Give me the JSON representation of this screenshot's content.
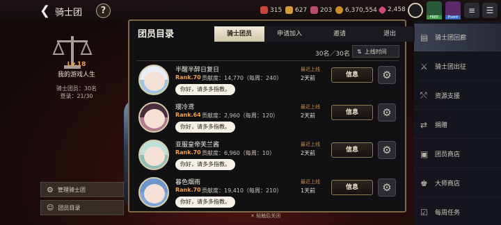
{
  "header": {
    "back_icon": "back-arrow-icon",
    "title": "骑士团",
    "help": "?",
    "resources": [
      {
        "icon": "energy-icon",
        "value": "315",
        "color": "#c9463a"
      },
      {
        "icon": "gold-bar-icon",
        "value": "627",
        "color": "#d59a3a"
      },
      {
        "icon": "ticket-icon",
        "value": "203",
        "color": "#b84a6a"
      },
      {
        "icon": "coin-icon",
        "value": "6,370,554",
        "color": "#c98c2a"
      },
      {
        "icon": "gem-icon",
        "value": "2,458",
        "color": "#d04a7a"
      }
    ],
    "badges": {
      "free": "FREE",
      "event": "Event"
    }
  },
  "guild": {
    "level": "Lv.18",
    "name": "我的游戏人生",
    "members": "骑士团员：30名",
    "online": "登录：21/30"
  },
  "left_buttons": {
    "manage": "管理骑士团",
    "member_list": "团员目录"
  },
  "modal": {
    "title": "团员目录",
    "tabs": [
      "骑士团员",
      "申请加入",
      "邀请",
      "退出"
    ],
    "count": "30名／30名",
    "sort_label": "上线时间",
    "login_label": "最近上线",
    "info_label": "信息",
    "members": [
      {
        "name": "半醒半醉日复日",
        "rank": "Rank.70",
        "contrib": "贡献度：14,770（每周：240）",
        "greeting": "你好，请多多指教。",
        "last_login": "2天前"
      },
      {
        "name": "璎冷鸢",
        "rank": "Rank.64",
        "contrib": "贡献度：2,960（每周：120）",
        "greeting": "你好，请多多指教。",
        "last_login": "2天前"
      },
      {
        "name": "亚服皇帝芙兰酱",
        "rank": "Rank.70",
        "contrib": "贡献度：6,960（每周：10）",
        "greeting": "你好，请多多指教。",
        "last_login": "2天前"
      },
      {
        "name": "暮色烟雨",
        "rank": "Rank.70",
        "contrib": "贡献度：19,410（每周：210）",
        "greeting": "你好，请多多指教。",
        "last_login": "1天前"
      }
    ]
  },
  "close_hint": "轻触后关闭",
  "right_nav": [
    {
      "icon": "guild-hall-icon",
      "label": "骑士团回廊"
    },
    {
      "icon": "crossed-swords-icon",
      "label": "骑士团出征"
    },
    {
      "icon": "shuffle-icon",
      "label": "资源支援"
    },
    {
      "icon": "donate-icon",
      "label": "捐赠"
    },
    {
      "icon": "shop-icon",
      "label": "团员商店"
    },
    {
      "icon": "master-shop-icon",
      "label": "大师商店"
    },
    {
      "icon": "weekly-task-icon",
      "label": "每周任务"
    }
  ]
}
